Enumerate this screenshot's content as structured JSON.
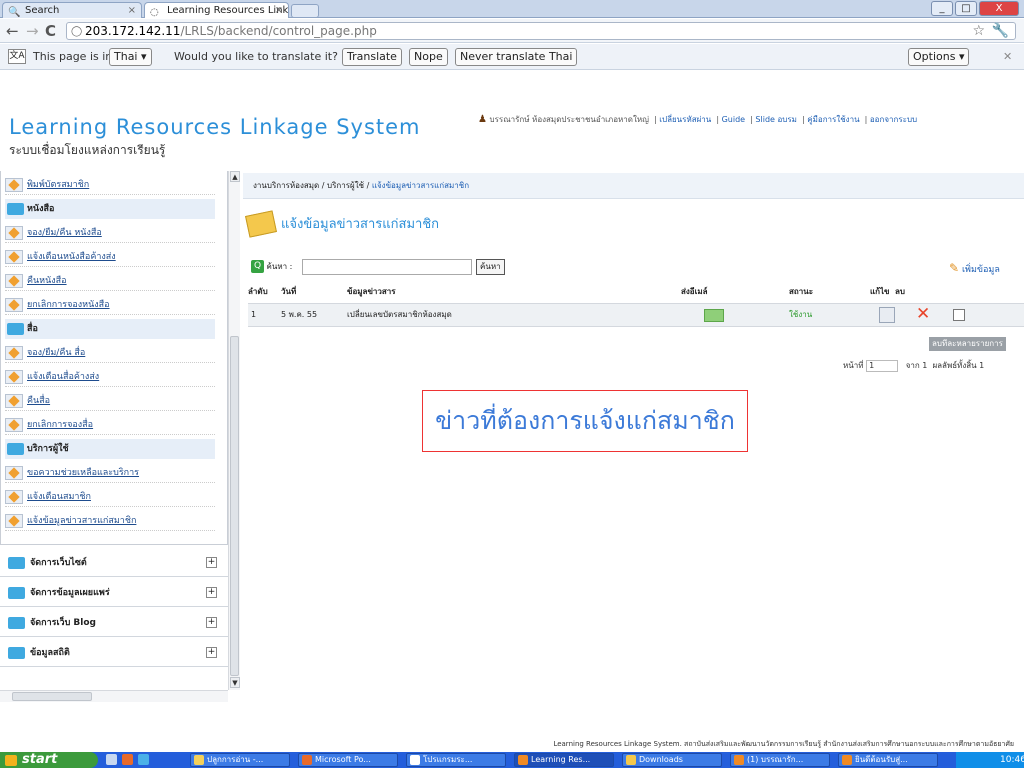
{
  "browser": {
    "tabs": [
      {
        "label": "Search",
        "active": false
      },
      {
        "label": "Learning Resources Linkage Sy",
        "active": true
      }
    ],
    "window_controls": [
      "_",
      "□",
      "X"
    ],
    "url_host": "203.172.142.11",
    "url_path": "/LRLS/backend/control_page.php"
  },
  "translate_bar": {
    "icon_label": "文A",
    "prefix": "This page is in",
    "language": "Thai ▾",
    "question": "Would you like to translate it?",
    "translate": "Translate",
    "nope": "Nope",
    "never": "Never translate Thai",
    "options": "Options ▾",
    "close": "✕"
  },
  "header": {
    "title": "Learning Resources Linkage System",
    "subtitle": "ระบบเชื่อมโยงแหล่งการเรียนรู้",
    "user": "บรรณารักษ์ ห้องสมุดประชาชนอำเภอหาดใหญ่",
    "links": [
      "เปลี่ยนรหัสผ่าน",
      "Guide",
      "Slide อบรม",
      "คู่มือการใช้งาน",
      "ออกจากระบบ"
    ]
  },
  "sidebar": {
    "items": [
      {
        "type": "item",
        "label": "พิมพ์บัตรสมาชิก"
      },
      {
        "type": "head",
        "label": "หนังสือ"
      },
      {
        "type": "item",
        "label": "จอง/ยืม/คืน หนังสือ"
      },
      {
        "type": "item",
        "label": "แจ้งเตือนหนังสือค้างส่ง"
      },
      {
        "type": "item",
        "label": "คืนหนังสือ"
      },
      {
        "type": "item",
        "label": "ยกเลิกการจองหนังสือ"
      },
      {
        "type": "head",
        "label": "สื่อ"
      },
      {
        "type": "item",
        "label": "จอง/ยืม/คืน สื่อ"
      },
      {
        "type": "item",
        "label": "แจ้งเตือนสื่อค้างส่ง"
      },
      {
        "type": "item",
        "label": "คืนสื่อ"
      },
      {
        "type": "item",
        "label": "ยกเลิกการจองสื่อ"
      },
      {
        "type": "head",
        "label": "บริการผู้ใช้"
      },
      {
        "type": "item",
        "label": "ขอความช่วยเหลือและบริการ"
      },
      {
        "type": "item",
        "label": "แจ้งเตือนสมาชิก"
      },
      {
        "type": "item",
        "label": "แจ้งข้อมูลข่าวสารแก่สมาชิก"
      }
    ],
    "groups": [
      "จัดการเว็บไซต์",
      "จัดการข้อมูลเผยแพร่",
      "จัดการเว็บ Blog",
      "ข้อมูลสถิติ"
    ],
    "plus": "+"
  },
  "main": {
    "breadcrumb_prefix": "งานบริการห้องสมุด / บริการผู้ใช้ / ",
    "breadcrumb_current": "แจ้งข้อมูลข่าวสารแก่สมาชิก",
    "page_title": "แจ้งข้อมูลข่าวสารแก่สมาชิก",
    "search_label": "ค้นหา :",
    "search_button": "ค้นหา",
    "add_link": "เพิ่มข้อมูล",
    "columns": [
      "ลำดับ",
      "วันที่",
      "ข้อมูลข่าวสาร",
      "ส่งอีเมล์",
      "สถานะ",
      "แก้ไข",
      "ลบ"
    ],
    "rows": [
      {
        "no": "1",
        "date": "5 พ.ค. 55",
        "news": "เปลี่ยนเลขบัตรสมาชิกห้องสมุด",
        "status": "ใช้งาน"
      }
    ],
    "bulk_delete": "ลบทีละหลายรายการ",
    "pager_page": "หน้าที่",
    "pager_current": "1",
    "pager_of": "จาก 1",
    "pager_total": "ผลลัพธ์ทั้งสิ้น 1",
    "annotation": "ข่าวที่ต้องการแจ้งแก่สมาชิก"
  },
  "footer": "Learning Resources Linkage System. สถาบันส่งเสริมและพัฒนานวัตกรรมการเรียนรู้ สำนักงานส่งเสริมการศึกษานอกระบบและการศึกษาตามอัธยาศัย",
  "taskbar": {
    "start": "start",
    "tasks": [
      {
        "label": "ปลูกการอ่าน -...",
        "active": false
      },
      {
        "label": "Microsoft Po...",
        "active": false
      },
      {
        "label": "โปรแกรมระ...",
        "active": false
      },
      {
        "label": "Learning Res...",
        "active": true
      },
      {
        "label": "Downloads",
        "active": false
      },
      {
        "label": "(1) บรรณารัก...",
        "active": false
      },
      {
        "label": "ยินดีต้อนรับสู่...",
        "active": false
      }
    ],
    "clock": "10:46"
  }
}
